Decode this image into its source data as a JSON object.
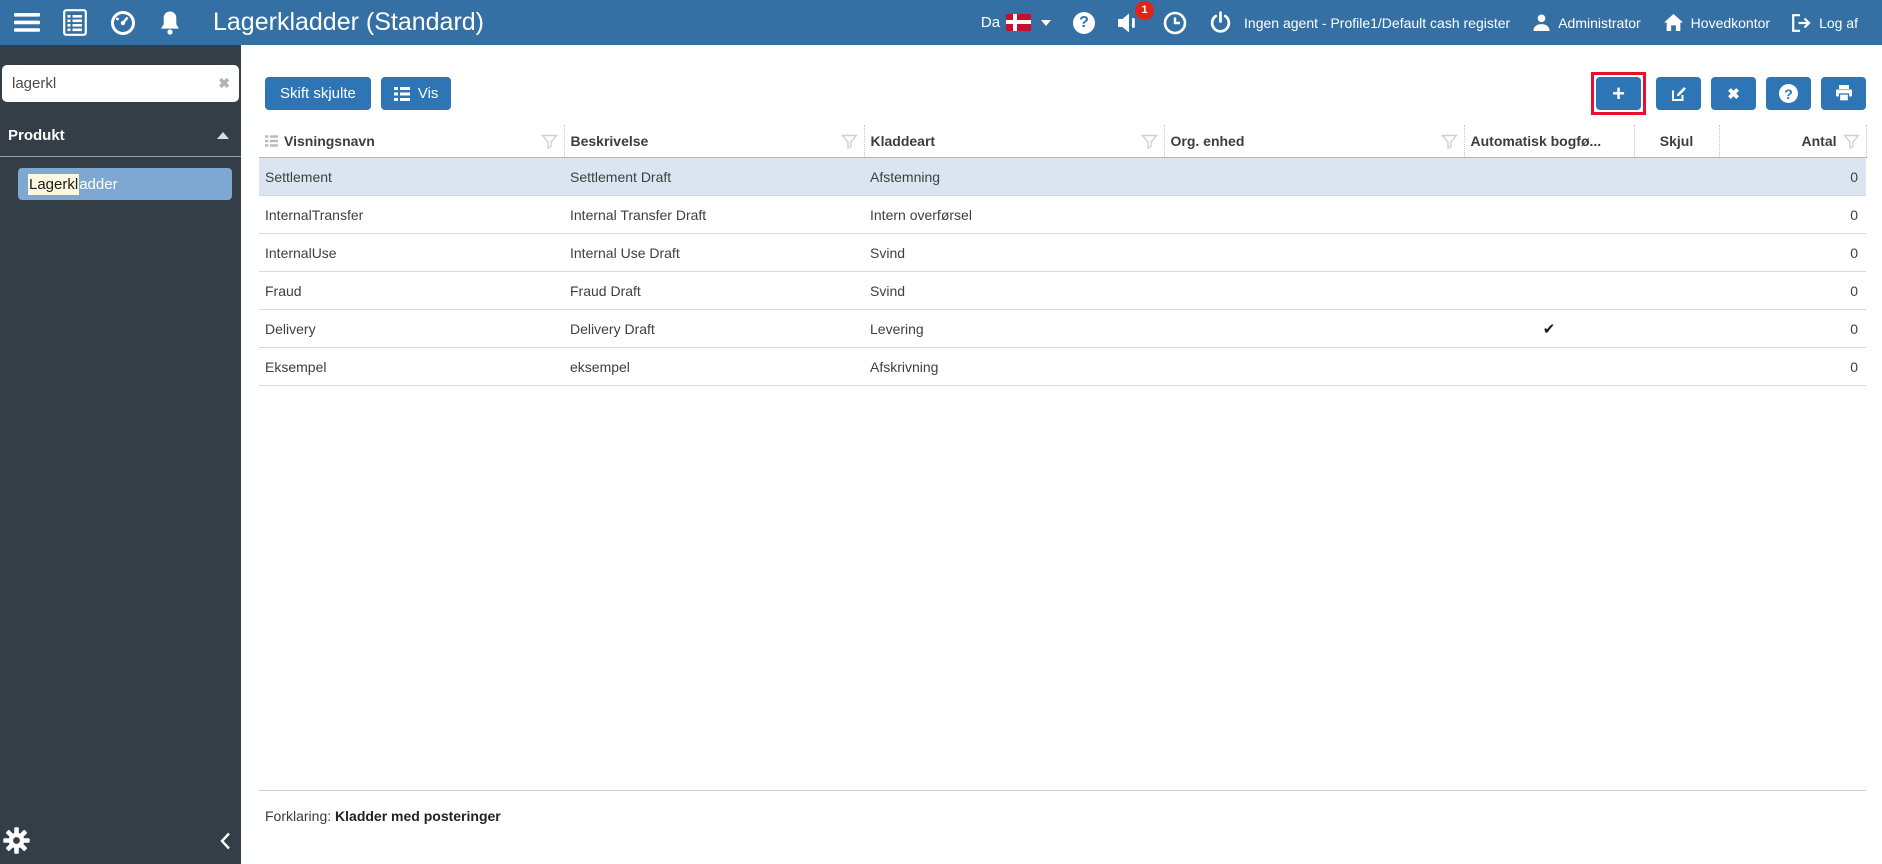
{
  "topbar": {
    "title": "Lagerkladder (Standard)",
    "language": "Da",
    "notification_count": "1",
    "agent_status": "Ingen agent - Profile1/Default cash register",
    "user": "Administrator",
    "location": "Hovedkontor",
    "logout_label": "Log af"
  },
  "sidebar": {
    "search_value": "lagerkl",
    "clear_glyph": "✖",
    "section_label": "Produkt",
    "item_match": "Lagerkl",
    "item_rest": "adder"
  },
  "toolbar": {
    "toggle_hidden_label": "Skift skjulte",
    "view_label": "Vis",
    "add_glyph": "+",
    "delete_glyph": "✖",
    "help_glyph": "?"
  },
  "table": {
    "columns": [
      {
        "label": "Visningsnavn",
        "funnel": true,
        "icon": true
      },
      {
        "label": "Beskrivelse",
        "funnel": true
      },
      {
        "label": "Kladdeart",
        "funnel": true
      },
      {
        "label": "Org. enhed",
        "funnel": true
      },
      {
        "label": "Automatisk bogfø...",
        "funnel": false
      },
      {
        "label": "Skjul",
        "funnel": false,
        "align": "center"
      },
      {
        "label": "Antal",
        "funnel": true,
        "align": "right"
      }
    ],
    "rows": [
      {
        "selected": true,
        "cells": [
          "Settlement",
          "Settlement Draft",
          "Afstemning",
          "",
          "",
          "",
          "0"
        ]
      },
      {
        "selected": false,
        "cells": [
          "InternalTransfer",
          "Internal Transfer Draft",
          "Intern overførsel",
          "",
          "",
          "",
          "0"
        ]
      },
      {
        "selected": false,
        "cells": [
          "InternalUse",
          "Internal Use Draft",
          "Svind",
          "",
          "",
          "",
          "0"
        ]
      },
      {
        "selected": false,
        "cells": [
          "Fraud",
          "Fraud Draft",
          "Svind",
          "",
          "",
          "",
          "0"
        ]
      },
      {
        "selected": false,
        "cells": [
          "Delivery",
          "Delivery Draft",
          "Levering",
          "",
          "✔",
          "",
          "0"
        ]
      },
      {
        "selected": false,
        "cells": [
          "Eksempel",
          "eksempel",
          "Afskrivning",
          "",
          "",
          "",
          "0"
        ]
      }
    ]
  },
  "footer": {
    "label": "Forklaring:",
    "value": "Kladder med posteringer"
  },
  "colors": {
    "topbar": "#3470A4",
    "button": "#2E75B6",
    "sidebar": "#333E47",
    "selected_row": "#DBE5F1",
    "annotation": "#E8112D",
    "badge": "#E2231A"
  }
}
